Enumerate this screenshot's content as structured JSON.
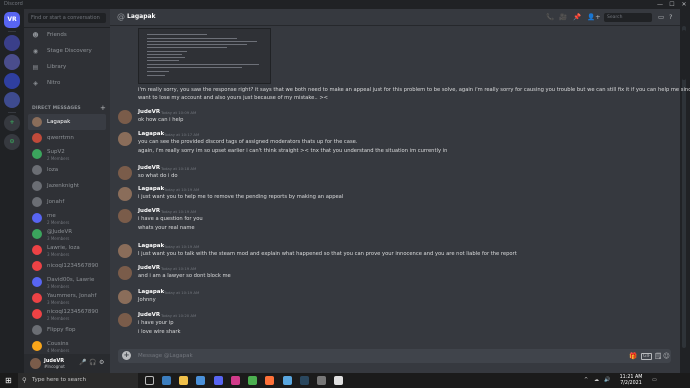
{
  "window": {
    "app_name": "Discord",
    "controls": [
      "—",
      "☐",
      "✕"
    ]
  },
  "guilds": [
    {
      "label": "VR"
    },
    {
      "label": "+"
    },
    {
      "label": "⊙"
    }
  ],
  "sidebar": {
    "search_placeholder": "Find or start a conversation",
    "nav": [
      {
        "label": "Friends",
        "icon": "friends-icon"
      },
      {
        "label": "Stage Discovery",
        "icon": "stage-icon"
      },
      {
        "label": "Library",
        "icon": "library-icon"
      },
      {
        "label": "Nitro",
        "icon": "nitro-icon"
      }
    ],
    "dm_header": "DIRECT MESSAGES",
    "dms": [
      {
        "name": "Lagapak",
        "sub": "",
        "color": "#8a6d5a"
      },
      {
        "name": "qwerrtmn",
        "sub": "",
        "color": "#c04a3a"
      },
      {
        "name": "SupV2",
        "sub": "2 Members",
        "color": "#3ba55d"
      },
      {
        "name": "loza",
        "sub": "",
        "color": "#6b6e74"
      },
      {
        "name": "Jazenknight",
        "sub": "",
        "color": "#6b6e74"
      },
      {
        "name": "Jonahf",
        "sub": "",
        "color": "#6b6e74"
      },
      {
        "name": "me",
        "sub": "2 Members",
        "color": "#5865f2"
      },
      {
        "name": "@JudeVR",
        "sub": "3 Members",
        "color": "#3ba55d"
      },
      {
        "name": "Lawrie, loza",
        "sub": "3 Members",
        "color": "#ed4245"
      },
      {
        "name": "nicoql1234567890",
        "sub": "",
        "color": "#ed4245"
      },
      {
        "name": "David00s, Lawrie",
        "sub": "3 Members",
        "color": "#5865f2"
      },
      {
        "name": "Yaummers, Jonahf",
        "sub": "3 Members",
        "color": "#ed4245"
      },
      {
        "name": "nicoql1234567890",
        "sub": "2 Members",
        "color": "#ed4245"
      },
      {
        "name": "Flippy flop",
        "sub": "",
        "color": "#6b6e74"
      },
      {
        "name": "Cousins",
        "sub": "4 Members",
        "color": "#faa61a"
      }
    ]
  },
  "user": {
    "name": "JudeVR",
    "tag": "#Incognot",
    "controls": [
      "🎤",
      "🎧",
      "⚙"
    ]
  },
  "chat": {
    "title": "Lagapak",
    "at": "@",
    "header_icons": [
      "📞",
      "🎥",
      "📌",
      "👤+"
    ],
    "search_placeholder": "Search",
    "continuation": [
      "i'm really sorry, you saw the response right? it says that we both need to make an appeal just for this problem to be solve, again i'm really sorry for causing you trouble but we can still fix it if you can help me since i dont",
      "want to lose my account and also yours just because of my mistake.. ><"
    ],
    "messages": [
      {
        "author": "JudeVR",
        "time": "Today at 10:09 AM",
        "lines": [
          "ok how can i help"
        ],
        "avatar_color": "#7a5c4a"
      },
      {
        "author": "Lagapak",
        "time": "Today at 10:17 AM",
        "lines": [
          "you can see the provided discord tags of assigned moderators thats up for the case.",
          "again, i'm really sorry im so upset earlier i can't think straight >< tnx that you understand the situation im currently in"
        ],
        "avatar_color": "#8a6d5a"
      },
      {
        "author": "JudeVR",
        "time": "Today at 10:18 AM",
        "lines": [
          "so what do i do"
        ],
        "avatar_color": "#7a5c4a"
      },
      {
        "author": "Lagapak",
        "time": "Today at 10:19 AM",
        "lines": [
          "i just want you to help me to remove the pending reports by making an appeal"
        ],
        "avatar_color": "#8a6d5a"
      },
      {
        "author": "JudeVR",
        "time": "Today at 10:19 AM",
        "lines": [
          "i have a question for you",
          "whats your real name"
        ],
        "avatar_color": "#7a5c4a"
      },
      {
        "author": "Lagapak",
        "time": "Today at 10:19 AM",
        "lines": [
          "I just want you to talk with the steam mod and explain what happened so that you can prove your innocence and you are not liable for the report"
        ],
        "avatar_color": "#8a6d5a"
      },
      {
        "author": "JudeVR",
        "time": "Today at 10:19 AM",
        "lines": [
          "and i am a lawyer so dont block me"
        ],
        "avatar_color": "#7a5c4a"
      },
      {
        "author": "Lagapak",
        "time": "Today at 10:19 AM",
        "lines": [
          "Johnny"
        ],
        "avatar_color": "#8a6d5a"
      },
      {
        "author": "JudeVR",
        "time": "Today at 10:20 AM",
        "lines": [
          "i have your ip",
          "i love wire shark"
        ],
        "avatar_color": "#7a5c4a"
      }
    ],
    "composer_placeholder": "Message @Lagapak",
    "composer_icons": [
      "🎁",
      "GIF",
      "🗒",
      "☺"
    ]
  },
  "taskbar": {
    "search_text": "Type here to search",
    "time": "11:21 AM",
    "date": "7/2/2021",
    "tray": [
      "^",
      "☁",
      "🔊"
    ]
  }
}
